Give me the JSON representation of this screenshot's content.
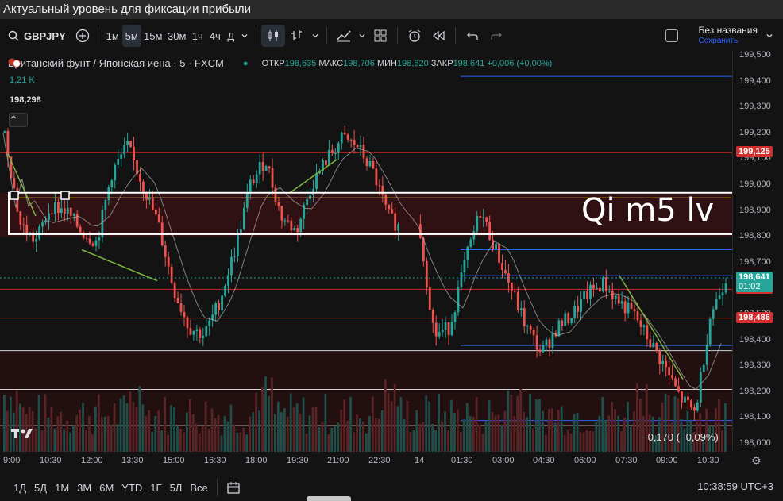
{
  "window": {
    "title": "Актуальный уровень для фиксации прибыли"
  },
  "toolbar": {
    "symbol": "GBPJPY",
    "intervals": [
      "1м",
      "5м",
      "15м",
      "30м",
      "1ч",
      "4ч",
      "Д"
    ],
    "active_interval": "5м",
    "layout_name": "Без названия",
    "save_label": "Сохранить"
  },
  "legend": {
    "instrument": "Британский фунт / Японская иена · 5 · FXCM",
    "open_label": "ОТКР",
    "open": "198,635",
    "high_label": "МАКС",
    "high": "198,706",
    "low_label": "МИН",
    "low": "198,620",
    "close_label": "ЗАКР",
    "close": "198,641",
    "change": "+0,006 (+0,00%)",
    "volume": "1,21 K",
    "top_price": "198,298"
  },
  "annotation": "Qi m5 lv",
  "measure_label": "−0,170 (−0,09%)",
  "price_axis": {
    "ticks": [
      "199,500",
      "199,400",
      "199,300",
      "199,200",
      "199,100",
      "199,000",
      "198,900",
      "198,800",
      "198,700",
      "198,600",
      "198,500",
      "198,400",
      "198,300",
      "198,200",
      "198,100",
      "198,000"
    ],
    "tags_red": [
      "199,125",
      "198,597",
      "198,486"
    ],
    "tag_current_price": "198,641",
    "tag_current_timer": "01:02"
  },
  "time_axis": {
    "ticks": [
      "9:00",
      "10:30",
      "12:00",
      "13:30",
      "15:00",
      "16:30",
      "18:00",
      "19:30",
      "21:00",
      "22:30",
      "14",
      "01:30",
      "03:00",
      "04:30",
      "06:00",
      "07:30",
      "09:00",
      "10:30"
    ]
  },
  "bottombar": {
    "ranges": [
      "1Д",
      "5Д",
      "1М",
      "3М",
      "6М",
      "YTD",
      "1Г",
      "5Л",
      "Все"
    ],
    "clock": "10:38:59 UTC+3"
  },
  "colors": {
    "up": "#26a69a",
    "down": "#ef5350",
    "level_red": "#d32f2f",
    "level_blue": "#2962ff",
    "accent": "#2962ff"
  },
  "chart_data": {
    "type": "candlestick",
    "symbol": "GBPJPY",
    "timeframe": "5",
    "ylim": [
      198.0,
      199.5
    ],
    "x_ticks": [
      "9:00",
      "10:30",
      "12:00",
      "13:30",
      "15:00",
      "16:30",
      "18:00",
      "19:30",
      "21:00",
      "22:30",
      "14",
      "01:30",
      "03:00",
      "04:30",
      "06:00",
      "07:30",
      "09:00",
      "10:30"
    ],
    "close_path": [
      199.2,
      198.85,
      198.78,
      198.92,
      198.9,
      198.82,
      198.78,
      199.05,
      199.15,
      199.0,
      198.85,
      198.6,
      198.45,
      198.42,
      198.55,
      198.75,
      199.0,
      199.1,
      198.88,
      198.82,
      199.0,
      199.1,
      199.18,
      199.15,
      199.05,
      198.88,
      198.82,
      198.85,
      198.42,
      198.45,
      198.7,
      198.9,
      198.75,
      198.6,
      198.45,
      198.35,
      198.45,
      198.5,
      198.58,
      198.62,
      198.55,
      198.5,
      198.4,
      198.3,
      198.18,
      198.12,
      198.5,
      198.64
    ],
    "levels": {
      "red": [
        199.125,
        198.597,
        198.486
      ],
      "blue": [
        199.42,
        198.75,
        198.65,
        198.38,
        198.09
      ],
      "white": [
        198.36,
        198.21,
        198.07
      ]
    },
    "zone": {
      "from": 198.8,
      "to": 198.97,
      "label": "Qi m5 lv"
    },
    "current_price": 198.641
  }
}
